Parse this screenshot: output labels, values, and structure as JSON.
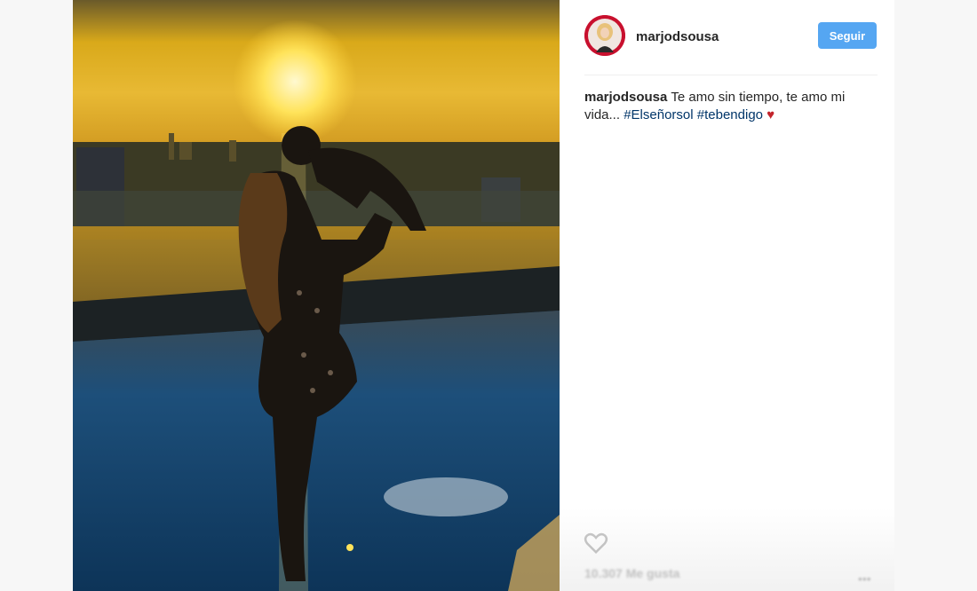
{
  "profile": {
    "username": "marjodsousa",
    "follow_label": "Seguir"
  },
  "caption": {
    "username": "marjodsousa",
    "text": "Te amo sin tiempo, te amo mi vida...",
    "hashtags": [
      "#Elseñorsol",
      "#tebendigo"
    ],
    "emoji_icon": "red-heart-icon"
  },
  "footer": {
    "like_icon": "heart-outline-icon",
    "likes_text": "10.307 Me gusta",
    "more_icon": "more-options-icon"
  },
  "colors": {
    "accent": "#3897f0",
    "hashtag": "#003569",
    "heart": "#c3252c"
  }
}
